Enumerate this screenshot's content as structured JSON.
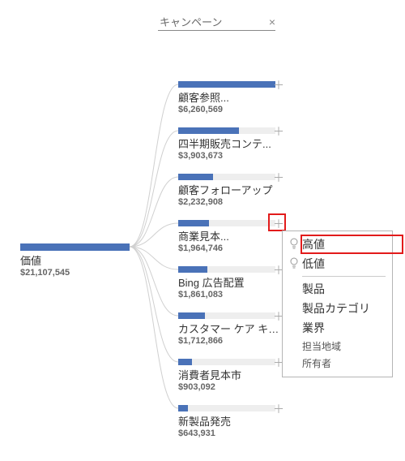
{
  "search": {
    "value": "キャンペーン",
    "clear_glyph": "×"
  },
  "root": {
    "label": "価値",
    "value_text": "$21,107,545",
    "value": 21107545
  },
  "children": [
    {
      "label": "顧客参照...",
      "value_text": "$6,260,569",
      "value": 6260569
    },
    {
      "label": "四半期販売コンテ...",
      "value_text": "$3,903,673",
      "value": 3903673
    },
    {
      "label": "顧客フォローアップ",
      "value_text": "$2,232,908",
      "value": 2232908
    },
    {
      "label": "商業見本...",
      "value_text": "$1,964,746",
      "value": 1964746
    },
    {
      "label": "Bing 広告配置",
      "value_text": "$1,861,083",
      "value": 1861083
    },
    {
      "label": "カスタマー ケア キャン...",
      "value_text": "$1,712,866",
      "value": 1712866
    },
    {
      "label": "消費者見本市",
      "value_text": "$903,092",
      "value": 903092
    },
    {
      "label": "新製品発売",
      "value_text": "$643,931",
      "value": 643931
    }
  ],
  "expand_glyph": "＋",
  "menu": {
    "items": [
      {
        "label": "高値",
        "insight": true
      },
      {
        "label": "低値",
        "insight": true
      },
      {
        "label": "製品"
      },
      {
        "label": "製品カテゴリ"
      },
      {
        "label": "業界"
      },
      {
        "label": "担当地域",
        "small": true
      },
      {
        "label": "所有者",
        "small": true
      }
    ],
    "highlight_index": 0
  },
  "chart_data": {
    "type": "bar",
    "title": "",
    "xlabel": "",
    "ylabel": "価値",
    "root": {
      "name": "価値",
      "value": 21107545
    },
    "breakdown_by": "キャンペーン",
    "categories": [
      "顧客参照",
      "四半期販売コンテ",
      "顧客フォローアップ",
      "商業見本",
      "Bing 広告配置",
      "カスタマー ケア キャン",
      "消費者見本市",
      "新製品発売"
    ],
    "values": [
      6260569,
      3903673,
      2232908,
      1964746,
      1861083,
      1712866,
      903092,
      643931
    ],
    "ylim": [
      0,
      7000000
    ]
  },
  "icons": {
    "bulb": "◌"
  }
}
